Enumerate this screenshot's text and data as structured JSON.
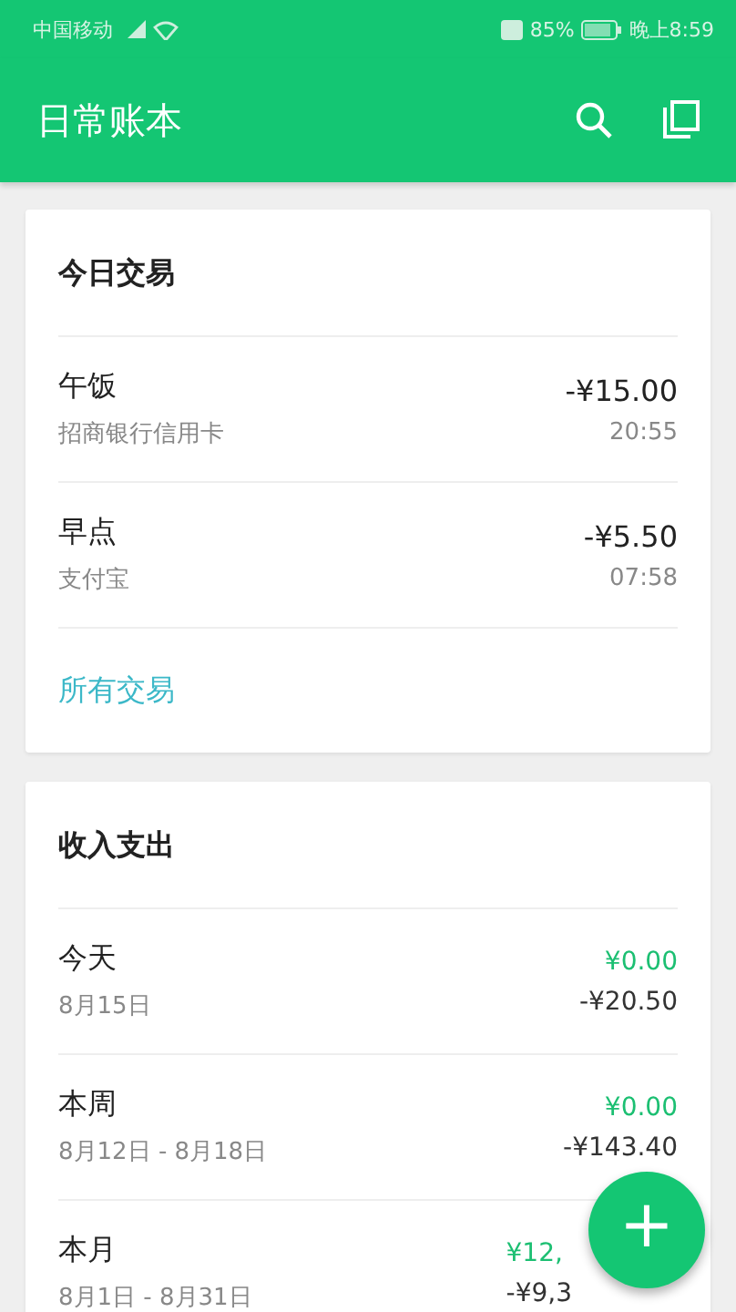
{
  "status_bar": {
    "carrier": "中国移动",
    "battery": "85%",
    "time": "晚上8:59"
  },
  "app_bar": {
    "title": "日常账本"
  },
  "today_card": {
    "title": "今日交易",
    "transactions": [
      {
        "name": "午饭",
        "account": "招商银行信用卡",
        "amount": "-¥15.00",
        "time": "20:55"
      },
      {
        "name": "早点",
        "account": "支付宝",
        "amount": "-¥5.50",
        "time": "07:58"
      }
    ],
    "link": "所有交易"
  },
  "summary_card": {
    "title": "收入支出",
    "periods": [
      {
        "name": "今天",
        "range": "8月15日",
        "income": "¥0.00",
        "expense": "-¥20.50",
        "partly_hidden": false
      },
      {
        "name": "本周",
        "range": "8月12日 - 8月18日",
        "income": "¥0.00",
        "expense": "-¥143.40",
        "partly_hidden": false
      },
      {
        "name": "本月",
        "range": "8月1日 - 8月31日",
        "income": "¥12,",
        "expense": "-¥9,3",
        "partly_hidden": true
      }
    ]
  },
  "fab": {
    "label": "+"
  }
}
